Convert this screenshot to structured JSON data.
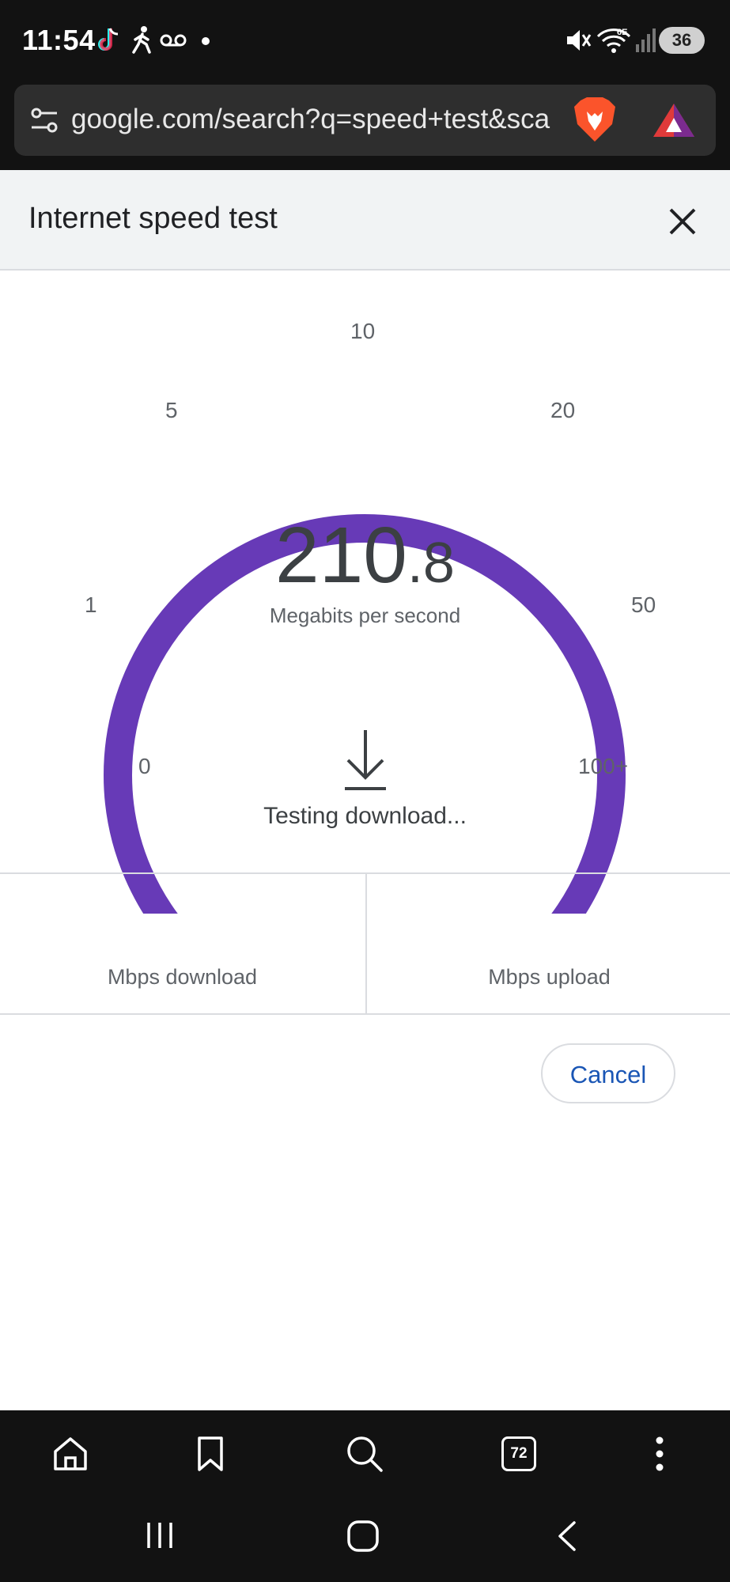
{
  "status_bar": {
    "time": "11:54",
    "battery": "36",
    "network": "6E"
  },
  "browser": {
    "url": "google.com/search?q=speed+test&sca"
  },
  "speed_test": {
    "title": "Internet speed test",
    "speed_integer": "210",
    "speed_decimal": ".8",
    "unit": "Megabits per second",
    "ticks": [
      "0",
      "1",
      "5",
      "10",
      "20",
      "50",
      "100+"
    ],
    "status": "Testing download...",
    "download_label": "Mbps download",
    "upload_label": "Mbps upload",
    "cancel_label": "Cancel",
    "gauge_fraction": 1.0,
    "accent_color": "#673ab7"
  },
  "nav": {
    "tab_count": "72"
  },
  "icons": [
    "tiktok-icon",
    "walk-icon",
    "voicemail-icon",
    "mute-icon",
    "wifi-icon",
    "signal-icon",
    "tune-icon",
    "brave-icon",
    "bat-icon",
    "close-icon",
    "download-arrow-icon",
    "home-icon",
    "bookmark-icon",
    "search-icon",
    "tabs-icon",
    "more-icon",
    "recents-icon",
    "home-button-icon",
    "back-icon"
  ]
}
